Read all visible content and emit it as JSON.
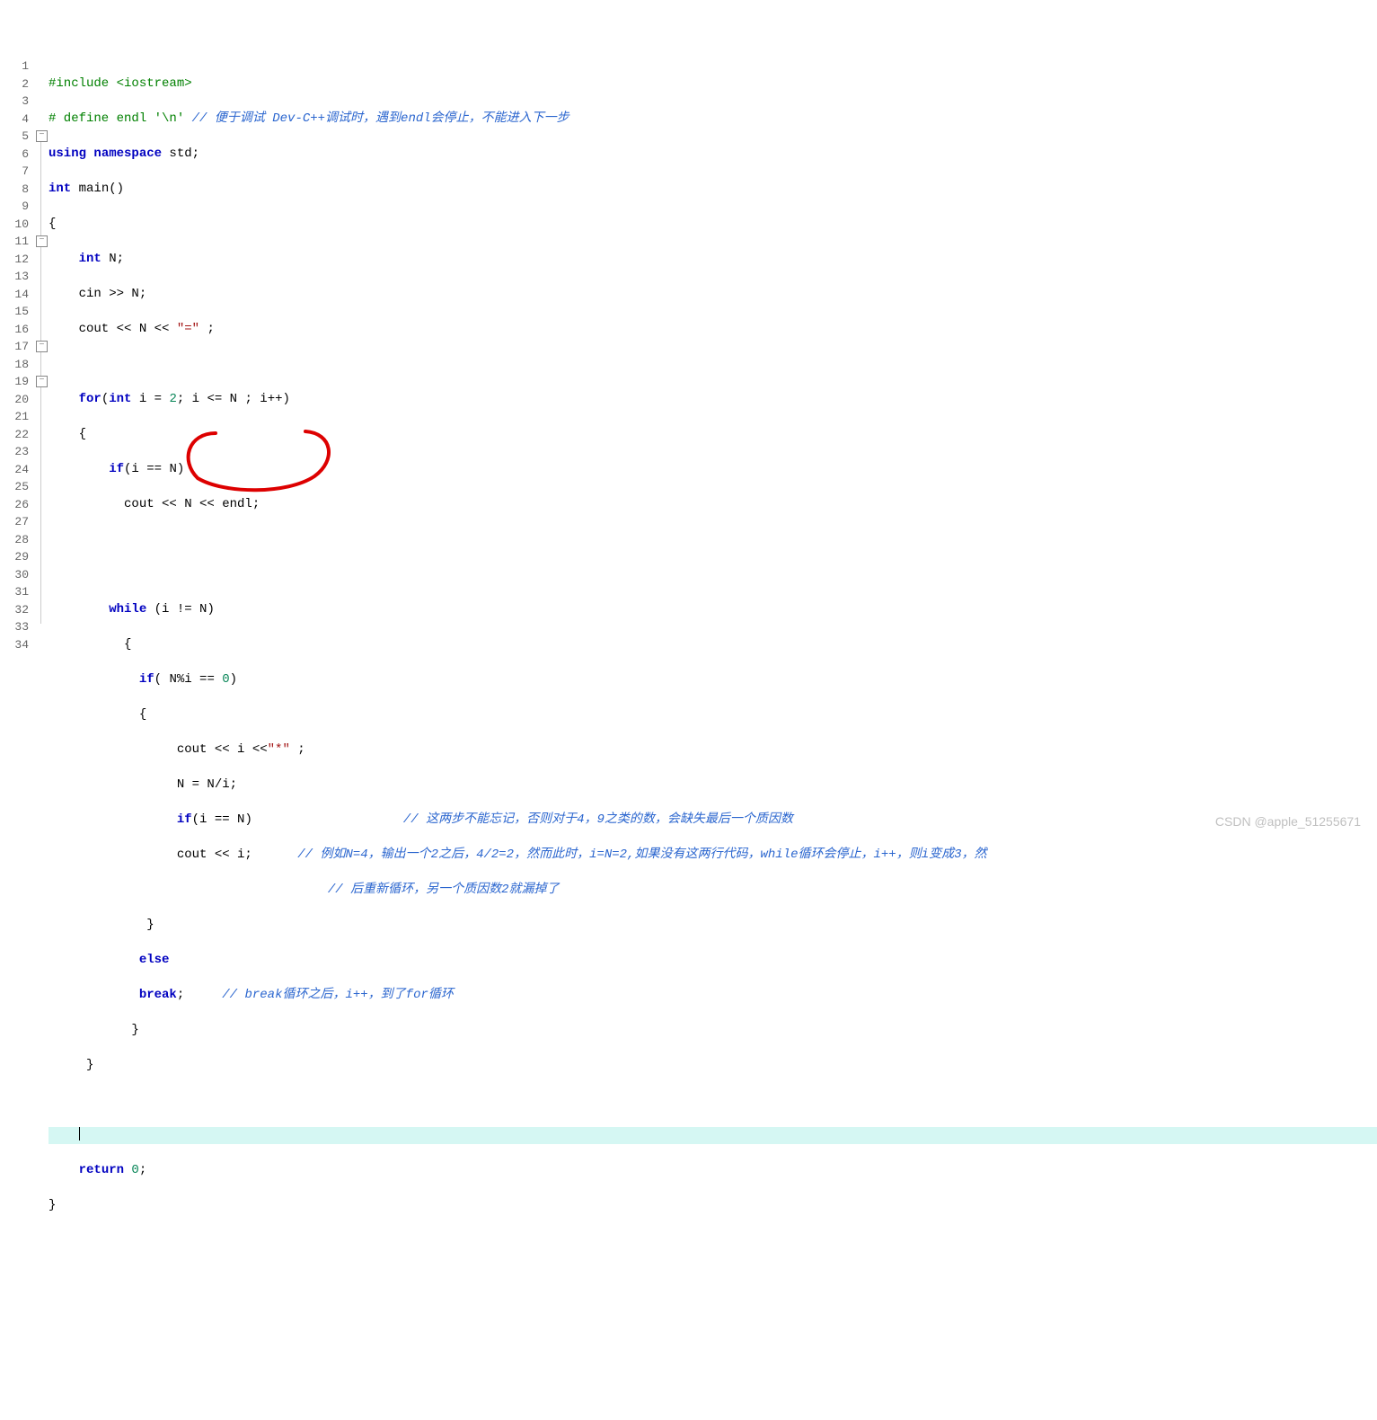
{
  "lineCount": 34,
  "highlightLine": 31,
  "foldBoxes": [
    5,
    11,
    17,
    19
  ],
  "code": {
    "l1_include": "#include ",
    "l1_header": "<iostream>",
    "l2_define": "# define endl '\\n' ",
    "l2_comment": "// 便于调试 Dev-C++调试时，遇到endl会停止，不能进入下一步",
    "l3_using": "using",
    "l3_ns": " namespace",
    "l3_std": " std;",
    "l4_int": "int",
    "l4_main": " main()",
    "l5": "{",
    "l6_int": "int",
    "l6_var": " N;",
    "l7": "    cin >> N;",
    "l8a": "    cout << N << ",
    "l8_str": "\"=\"",
    "l8b": " ;",
    "l10_for": "for",
    "l10a": "(",
    "l10_int": "int",
    "l10b": " i = ",
    "l10_2": "2",
    "l10c": "; i <= N ; i++)",
    "l11": "    {",
    "l12_if": "if",
    "l12c": "(i == N)",
    "l13": "          cout << N << endl;",
    "l16_while": "while",
    "l16c": " (i != N)",
    "l17": "          {",
    "l18_if": "if",
    "l18c": "( N%i == ",
    "l18_0": "0",
    "l18d": ")",
    "l19": "            {",
    "l20a": "                 cout << i <<",
    "l20_str": "\"*\"",
    "l20b": " ;",
    "l21": "                 N = N/i;",
    "l22_if": "if",
    "l22c": "(i == N)",
    "l22_comment": "// 这两步不能忘记，否则对于4，9之类的数，会缺失最后一个质因数",
    "l23": "                 cout << i;",
    "l23_comment": "// 例如N=4，输出一个2之后，4/2=2，然而此时，i=N=2,如果没有这两行代码，while循环会停止，i++，则i变成3，然",
    "l24_comment": "// 后重新循环，另一个质因数2就漏掉了",
    "l25": "             }",
    "l26_else": "else",
    "l27_break": "break",
    "l27b": ";",
    "l27_comment": "// break循环之后，i++，到了for循环",
    "l28": "           }",
    "l29": "     }",
    "l32_return": "return",
    "l32_0": " 0",
    "l32b": ";",
    "l33": "}"
  },
  "watermark": "CSDN @apple_51255671"
}
